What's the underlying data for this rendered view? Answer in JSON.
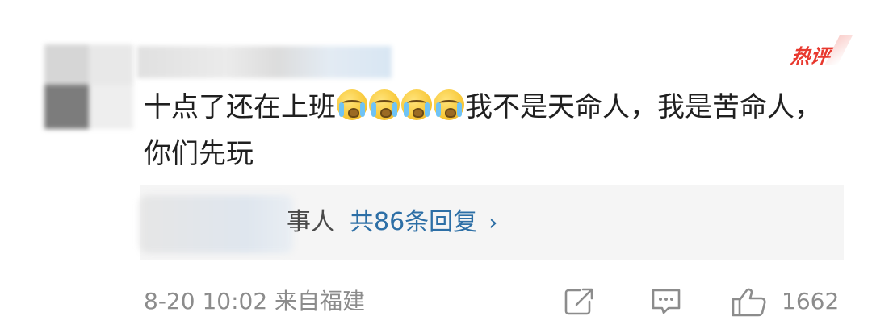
{
  "badge": {
    "hot_label": "热评"
  },
  "comment": {
    "text_before": "十点了还在上班",
    "emoji_name": "crying-face-emoji",
    "emoji_count": 4,
    "text_after": "我不是天命人，我是苦命人，你们先玩"
  },
  "replies": {
    "visible_author_fragment": "事人",
    "count_label": "共86条回复",
    "chevron": "›"
  },
  "footer": {
    "timestamp": "8-20 10:02",
    "location": "来自福建",
    "like_count": "1662"
  },
  "icons": {
    "share": "share-icon",
    "comment": "comment-icon",
    "like": "thumbs-up-icon"
  },
  "colors": {
    "hot_badge": "#e8382e",
    "link": "#2d6fa6",
    "muted": "#8c8c8c",
    "reply_bg": "#f5f5f5"
  }
}
